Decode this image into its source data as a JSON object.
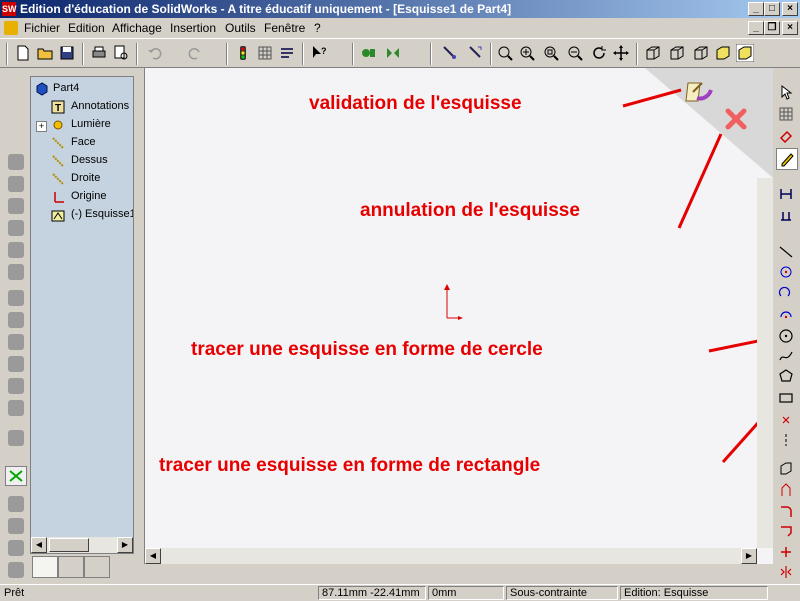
{
  "window": {
    "logo_text": "SW",
    "title": "Edition d'éducation de SolidWorks - A titre éducatif uniquement - [Esquisse1 de Part4]",
    "minimize": "_",
    "maximize": "□",
    "close": "×"
  },
  "menu": [
    "Fichier",
    "Edition",
    "Affichage",
    "Insertion",
    "Outils",
    "Fenêtre",
    "?"
  ],
  "tree": {
    "root": "Part4",
    "items": [
      "Annotations",
      "Lumière",
      "Face",
      "Dessus",
      "Droite",
      "Origine",
      "(-) Esquisse1"
    ],
    "expand": "+"
  },
  "annotations": {
    "validate": "validation de l'esquisse",
    "cancel": "annulation de l'esquisse",
    "circle": "tracer une esquisse en forme de cercle",
    "rectangle": "tracer une esquisse en forme de rectangle"
  },
  "status": {
    "ready": "Prêt",
    "coords": "87.11mm -22.41mm",
    "z": "0mm",
    "constraint": "Sous-contrainte",
    "mode": "Edition: Esquisse"
  },
  "colors": {
    "annotation": "#e60000",
    "tree_bg": "#c5d3e0",
    "canvas_bg": "#f4f4f7"
  }
}
